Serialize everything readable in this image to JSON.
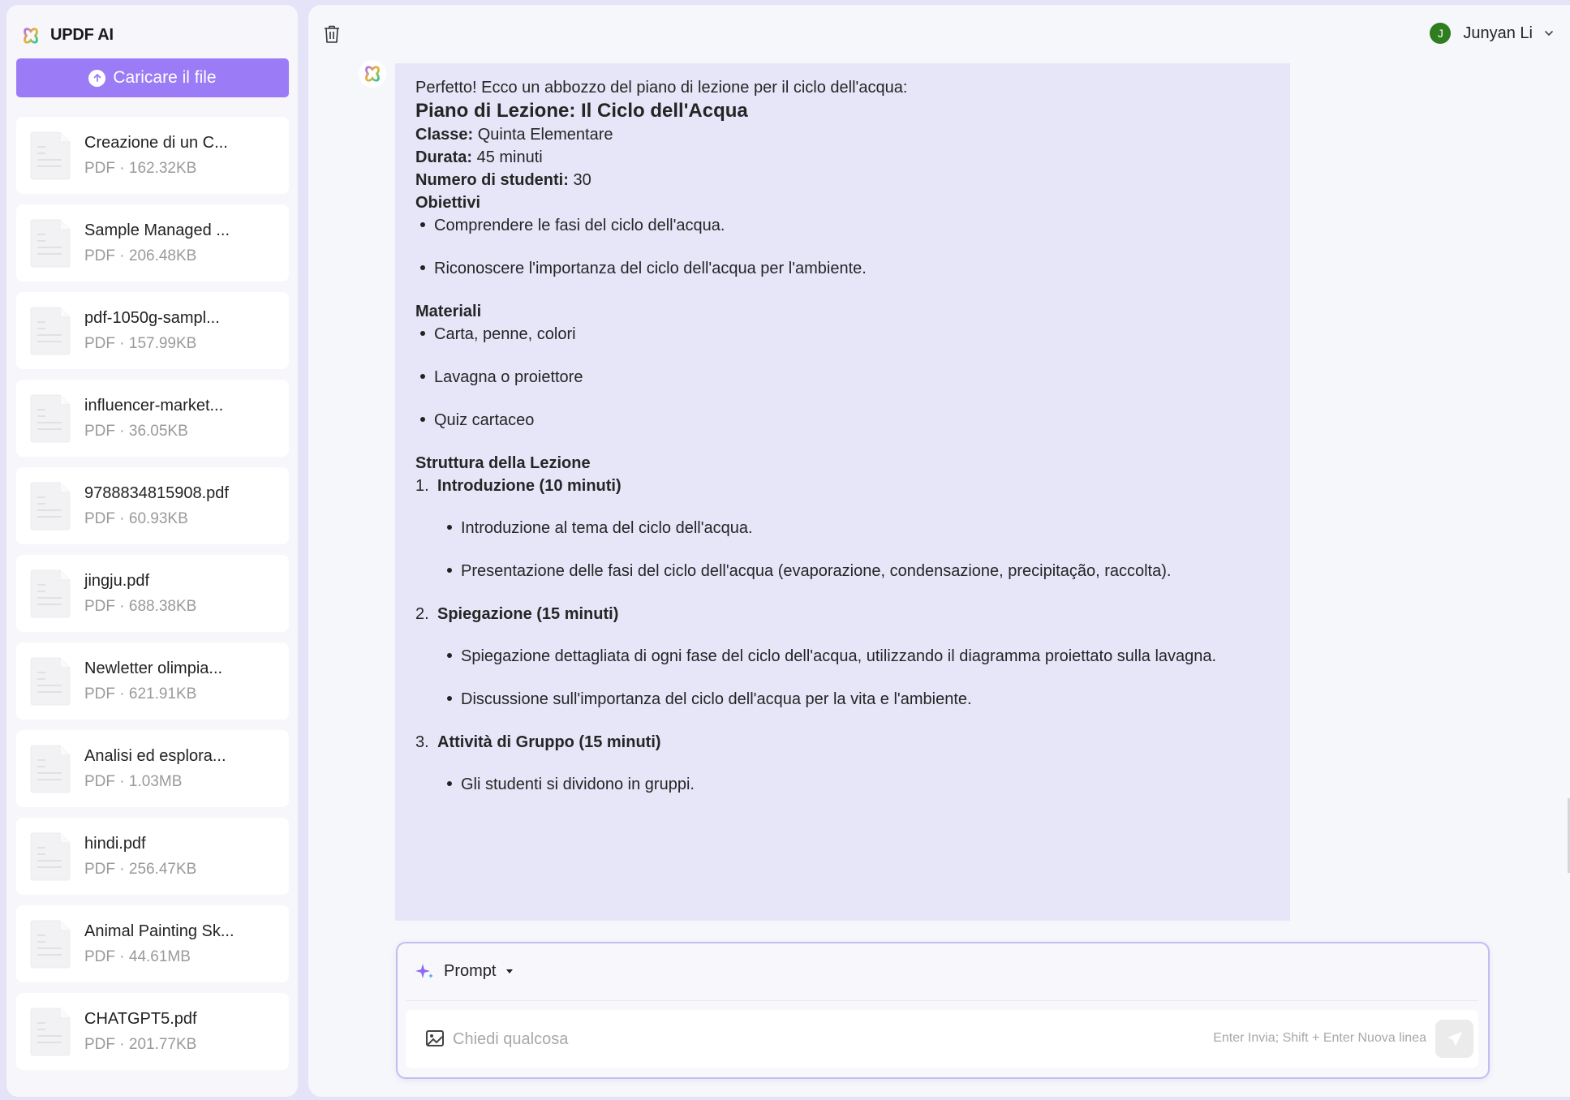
{
  "sidebar": {
    "app_name": "UPDF AI",
    "upload_label": "Caricare il file",
    "files": [
      {
        "name": "Creazione di un C...",
        "size": "PDF · 162.32KB"
      },
      {
        "name": "Sample Managed ...",
        "size": "PDF · 206.48KB"
      },
      {
        "name": "pdf-1050g-sampl...",
        "size": "PDF · 157.99KB"
      },
      {
        "name": "influencer-market...",
        "size": "PDF · 36.05KB"
      },
      {
        "name": "9788834815908.pdf",
        "size": "PDF · 60.93KB"
      },
      {
        "name": "jingju.pdf",
        "size": "PDF · 688.38KB"
      },
      {
        "name": "Newletter olimpia...",
        "size": "PDF · 621.91KB"
      },
      {
        "name": "Analisi ed esplora...",
        "size": "PDF · 1.03MB"
      },
      {
        "name": "hindi.pdf",
        "size": "PDF · 256.47KB"
      },
      {
        "name": "Animal Painting Sk...",
        "size": "PDF · 44.61MB"
      },
      {
        "name": "CHATGPT5.pdf",
        "size": "PDF · 201.77KB"
      }
    ]
  },
  "header": {
    "user_initial": "J",
    "user_name": "Junyan Li",
    "avatar_color": "#2f7d1f"
  },
  "message": {
    "intro": "Perfetto! Ecco un abbozzo del piano di lezione per il ciclo dell'acqua:",
    "title": "Piano di Lezione: Il Ciclo dell'Acqua",
    "details": [
      {
        "key": "Classe:",
        "value": " Quinta Elementare"
      },
      {
        "key": "Durata:",
        "value": " 45 minuti"
      },
      {
        "key": "Numero di studenti:",
        "value": " 30"
      }
    ],
    "objectives_heading": "Obiettivi",
    "objectives": [
      "Comprendere le fasi del ciclo dell'acqua.",
      "Riconoscere l'importanza del ciclo dell'acqua per l'ambiente."
    ],
    "materials_heading": "Materiali",
    "materials": [
      "Carta, penne, colori",
      "Lavagna o proiettore",
      "Quiz cartaceo"
    ],
    "structure_heading": "Struttura della Lezione",
    "structure": [
      {
        "num": "1.",
        "label": "Introduzione (10 minuti)",
        "items": [
          "Introduzione al tema del ciclo dell'acqua.",
          "Presentazione delle fasi del ciclo dell'acqua (evaporazione, condensazione, precipitação, raccolta)."
        ]
      },
      {
        "num": "2.",
        "label": "Spiegazione (15 minuti)",
        "items": [
          "Spiegazione dettagliata di ogni fase del ciclo dell'acqua, utilizzando il diagramma proiettato sulla lavagna.",
          "Discussione sull'importanza del ciclo dell'acqua per la vita e l'ambiente."
        ]
      },
      {
        "num": "3.",
        "label": "Attività di Gruppo (15 minuti)",
        "items": [
          "Gli studenti si dividono in gruppi."
        ]
      }
    ]
  },
  "composer": {
    "prompt_label": "Prompt",
    "input_value": "",
    "input_placeholder": "Chiedi qualcosa",
    "hint": "Enter Invia; Shift + Enter Nuova linea"
  },
  "colors": {
    "accent": "#9b7cf6",
    "bubble_bg": "#e7e6f9",
    "page_bg": "#e4e3f7"
  }
}
